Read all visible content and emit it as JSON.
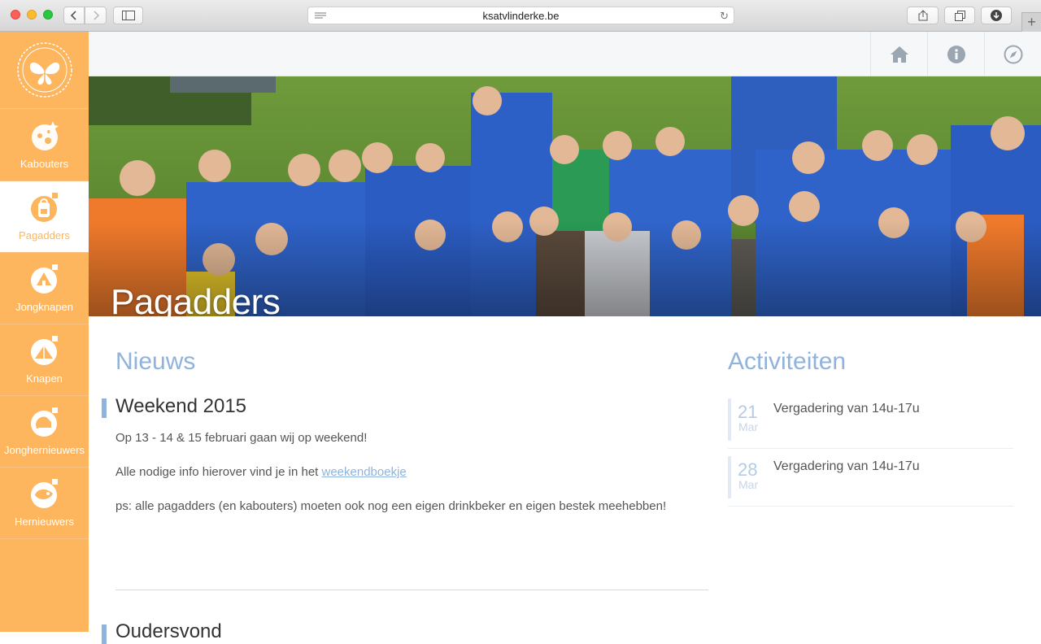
{
  "browser": {
    "url": "ksatvlinderke.be"
  },
  "sidebar": {
    "items": [
      {
        "label": "Kabouters",
        "icon": "kabouters-icon"
      },
      {
        "label": "Pagadders",
        "icon": "pagadders-icon",
        "active": true
      },
      {
        "label": "Jongknapen",
        "icon": "jongknapen-icon"
      },
      {
        "label": "Knapen",
        "icon": "knapen-icon"
      },
      {
        "label": "Jonghernieuwers",
        "icon": "jonghernieuwers-icon"
      },
      {
        "label": "Hernieuwers",
        "icon": "hernieuwers-icon"
      }
    ]
  },
  "topbar": {
    "icons": [
      "home-icon",
      "info-icon",
      "compass-icon"
    ]
  },
  "hero": {
    "title": "Pagadders"
  },
  "news": {
    "heading": "Nieuws",
    "posts": [
      {
        "title": "Weekend 2015",
        "p1": "Op 13 - 14 & 15 februari gaan wij op weekend!",
        "p2_prefix": "Alle nodige info hierover vind je in het ",
        "p2_link": "weekendboekje",
        "p3": "ps: alle pagadders (en kabouters) moeten ook nog een eigen drinkbeker en eigen bestek meehebben!"
      },
      {
        "title": "Oudersvond"
      }
    ]
  },
  "activities": {
    "heading": "Activiteiten",
    "items": [
      {
        "day": "21",
        "month": "Mar",
        "title": "Vergadering van 14u-17u"
      },
      {
        "day": "28",
        "month": "Mar",
        "title": "Vergadering van 14u-17u"
      }
    ]
  },
  "colors": {
    "orange": "#fdb55e",
    "blue": "#8fb3dd"
  }
}
